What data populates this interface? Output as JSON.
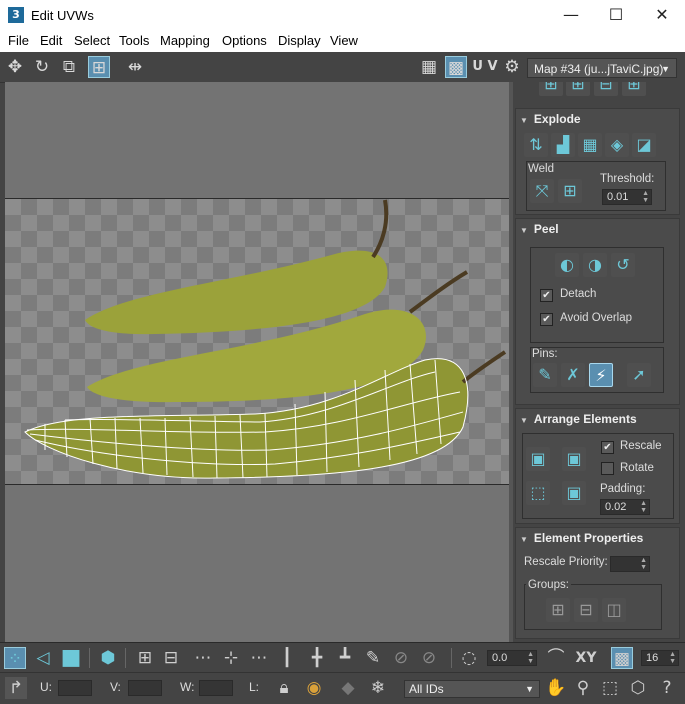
{
  "window": {
    "title": "Edit UVWs",
    "app_icon": "3",
    "minimize": "—",
    "maximize": "☐",
    "close": "✕"
  },
  "menu": [
    "File",
    "Edit",
    "Select",
    "Tools",
    "Mapping",
    "Options",
    "Display",
    "View"
  ],
  "toolbar": {
    "uv_label": "U V",
    "map_dropdown": "Map #34 (ju...jTaviC.jpg)"
  },
  "panel": {
    "explode": {
      "title": "Explode",
      "weld_label": "Weld",
      "threshold_label": "Threshold:",
      "threshold_value": "0.01"
    },
    "peel": {
      "title": "Peel",
      "detach_label": "Detach",
      "detach_checked": true,
      "avoid_overlap_label": "Avoid Overlap",
      "avoid_overlap_checked": true,
      "pins_label": "Pins:"
    },
    "arrange": {
      "title": "Arrange Elements",
      "rescale_label": "Rescale",
      "rescale_checked": true,
      "rotate_label": "Rotate",
      "rotate_checked": false,
      "padding_label": "Padding:",
      "padding_value": "0.02"
    },
    "element_props": {
      "title": "Element Properties",
      "rescale_priority_label": "Rescale Priority:",
      "groups_label": "Groups:"
    }
  },
  "bottom": {
    "angle_value": "0.0",
    "xy_label": "XY",
    "grid_value": "16",
    "u_label": "U:",
    "v_label": "V:",
    "w_label": "W:",
    "l_label": "L:",
    "ids_dropdown": "All IDs"
  },
  "colors": {
    "accent": "#6dc8d8",
    "active": "#5a8fb0",
    "mesh": "#ffffff",
    "pepper": "#9ba23a"
  }
}
